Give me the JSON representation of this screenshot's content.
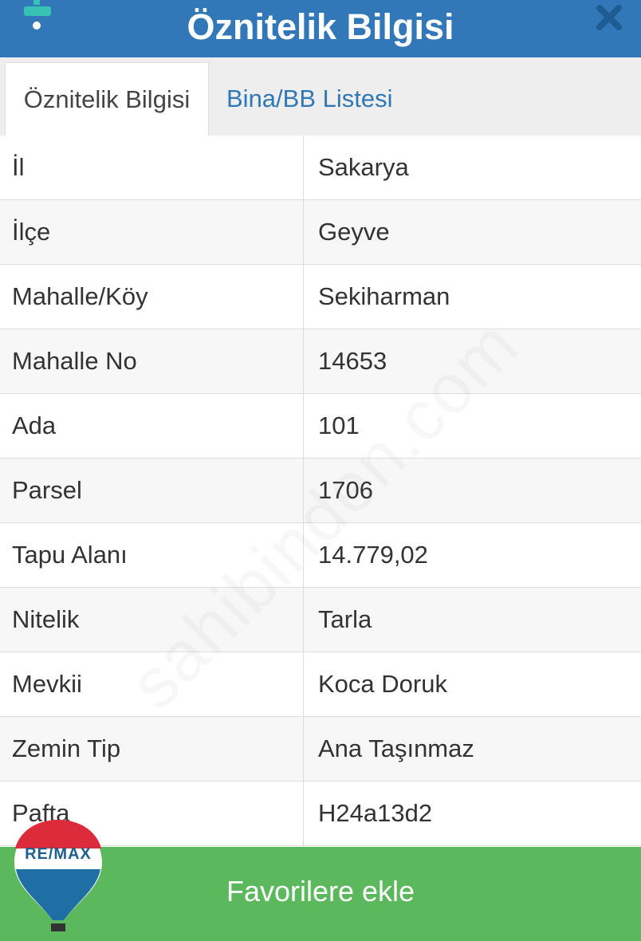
{
  "header": {
    "title": "Öznitelik Bilgisi",
    "close_icon": "close-icon",
    "layers_icon": "layers-icon"
  },
  "tabs": [
    {
      "label": "Öznitelik Bilgisi",
      "active": true
    },
    {
      "label": "Bina/BB Listesi",
      "active": false
    }
  ],
  "rows": [
    {
      "key": "İl",
      "value": "Sakarya"
    },
    {
      "key": "İlçe",
      "value": "Geyve"
    },
    {
      "key": "Mahalle/Köy",
      "value": "Sekiharman"
    },
    {
      "key": "Mahalle No",
      "value": "14653"
    },
    {
      "key": "Ada",
      "value": "101"
    },
    {
      "key": "Parsel",
      "value": "1706"
    },
    {
      "key": "Tapu Alanı",
      "value": "14.779,02"
    },
    {
      "key": "Nitelik",
      "value": "Tarla"
    },
    {
      "key": "Mevkii",
      "value": "Koca Doruk"
    },
    {
      "key": "Zemin Tip",
      "value": "Ana Taşınmaz"
    },
    {
      "key": "Pafta",
      "value": "H24a13d2"
    }
  ],
  "watermark": "sahibinden.com",
  "favorite_button": {
    "label": "Favorilere ekle"
  },
  "logo": {
    "text": "RE/MAX"
  },
  "colors": {
    "header_bg": "#3278b9",
    "tab_link": "#3078b4",
    "button_bg": "#5cb85c"
  }
}
